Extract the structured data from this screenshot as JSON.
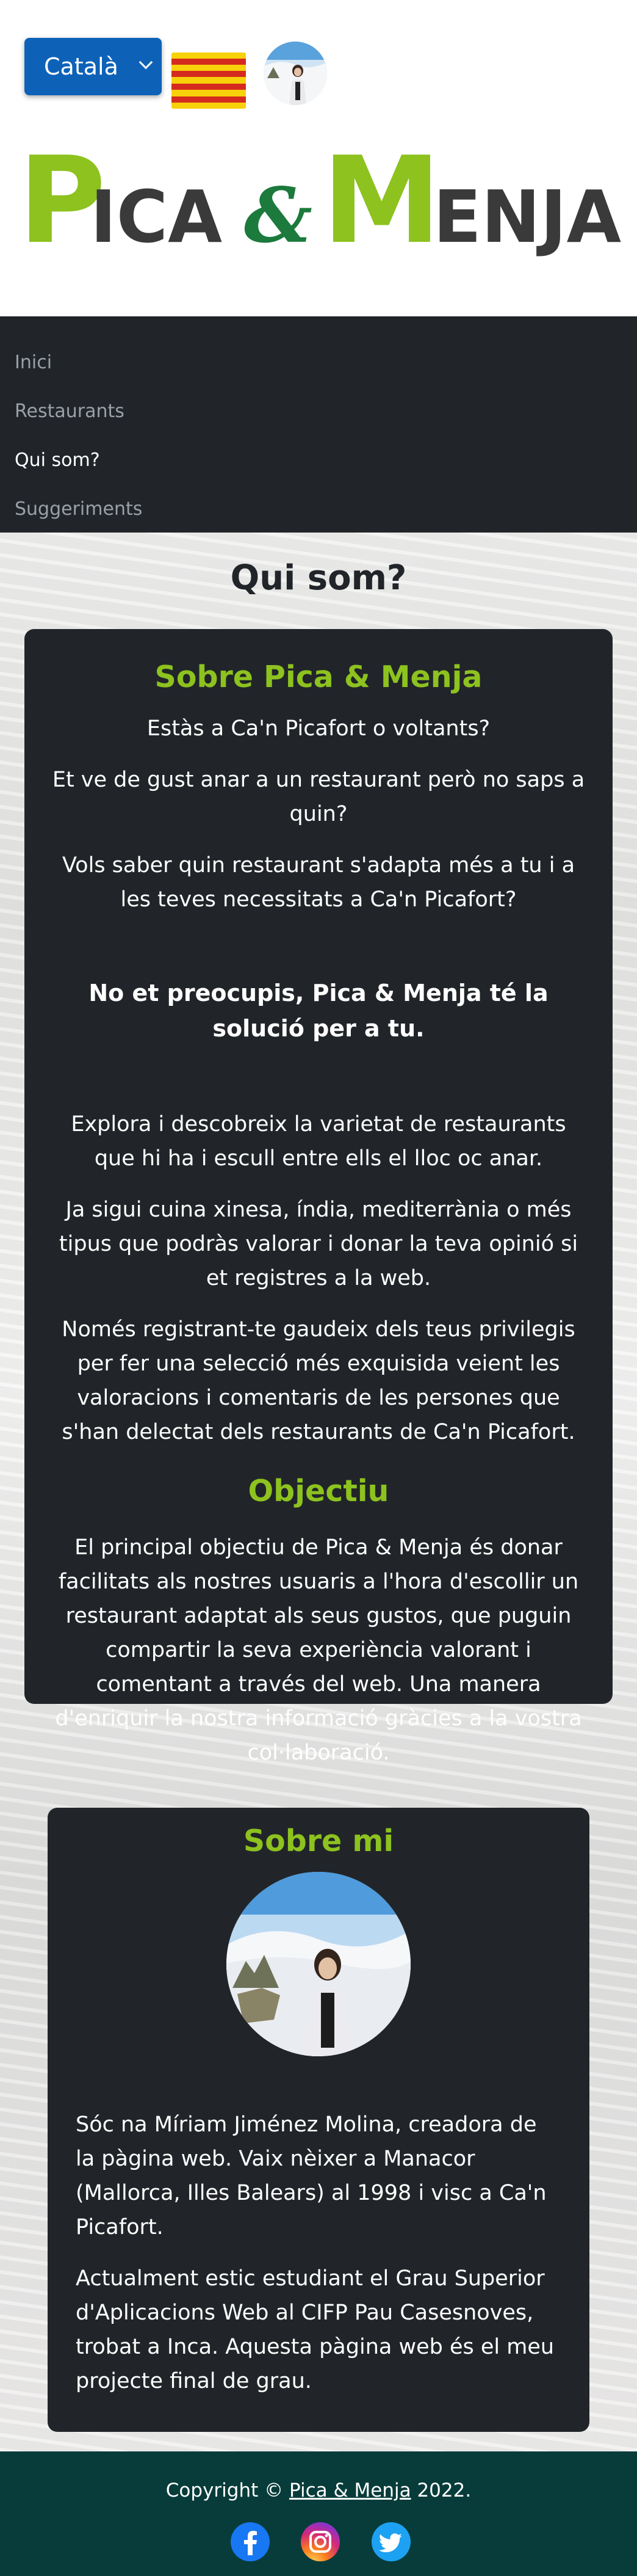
{
  "header": {
    "language_selected": "Català",
    "logo": {
      "text": "Pica & Menja",
      "p": "P",
      "ica": "ICA",
      "amp": "&",
      "m": "M",
      "enja": "ENJA"
    }
  },
  "nav": {
    "items": [
      {
        "label": "Inici"
      },
      {
        "label": "Restaurants"
      },
      {
        "label": "Qui som?"
      },
      {
        "label": "Suggeriments"
      }
    ]
  },
  "main": {
    "page_title": "Qui som?",
    "about": {
      "title": "Sobre Pica & Menja",
      "p1": "Estàs a Ca'n Picafort o voltants?",
      "p2": "Et ve de gust anar a un restaurant però no saps a quin?",
      "p3": "Vols saber quin restaurant s'adapta més a tu i a les teves necessitats a Ca'n Picafort?",
      "highlight": "No et preocupis, Pica & Menja té la solució per a tu.",
      "p4": "Explora i descobreix la varietat de restaurants que hi ha i escull entre ells el lloc oc anar.",
      "p5": "Ja sigui cuina xinesa, índia, mediterrània o més tipus que podràs valorar i donar la teva opinió si et registres a la web.",
      "p6": "Només registrant-te gaudeix dels teus privilegis per fer una selecció més exquisida veient les valoracions i comentaris de les persones que s'han delectat dels restaurants de Ca'n Picafort."
    },
    "objective": {
      "title": "Objectiu",
      "text": "El principal objectiu de Pica & Menja és donar facilitats als nostres usuaris a l'hora d'escollir un restaurant adaptat als seus gustos, que puguin compartir la seva experiència valorant i comentant a través del web. Una manera d'enriquir la nostra informació gràcies a la vostra col·laboració."
    },
    "me": {
      "title": "Sobre mi",
      "p1": "Sóc na Míriam Jiménez Molina, creadora de la pàgina web. Vaix nèixer a Manacor (Mallorca, Illes Balears) al 1998 i visc a Ca'n Picafort.",
      "p2": "Actualment estic estudiant el Grau Superior d'Aplicacions Web al CIFP Pau Casesnoves, trobat a Inca. Aquesta pàgina web és el meu projecte final de grau."
    }
  },
  "footer": {
    "copyright_prefix": "Copyright ©",
    "site_link": "Pica & Menja",
    "year_suffix": "2022.",
    "social": [
      {
        "icon": "facebook-icon"
      },
      {
        "icon": "instagram-icon"
      },
      {
        "icon": "twitter-icon"
      }
    ]
  },
  "colors": {
    "brand_green": "#8dc21f",
    "dark_green": "#1b7a3c",
    "card_dark": "#212529",
    "footer_teal": "#073c3a",
    "select_blue": "#0d62b8"
  }
}
